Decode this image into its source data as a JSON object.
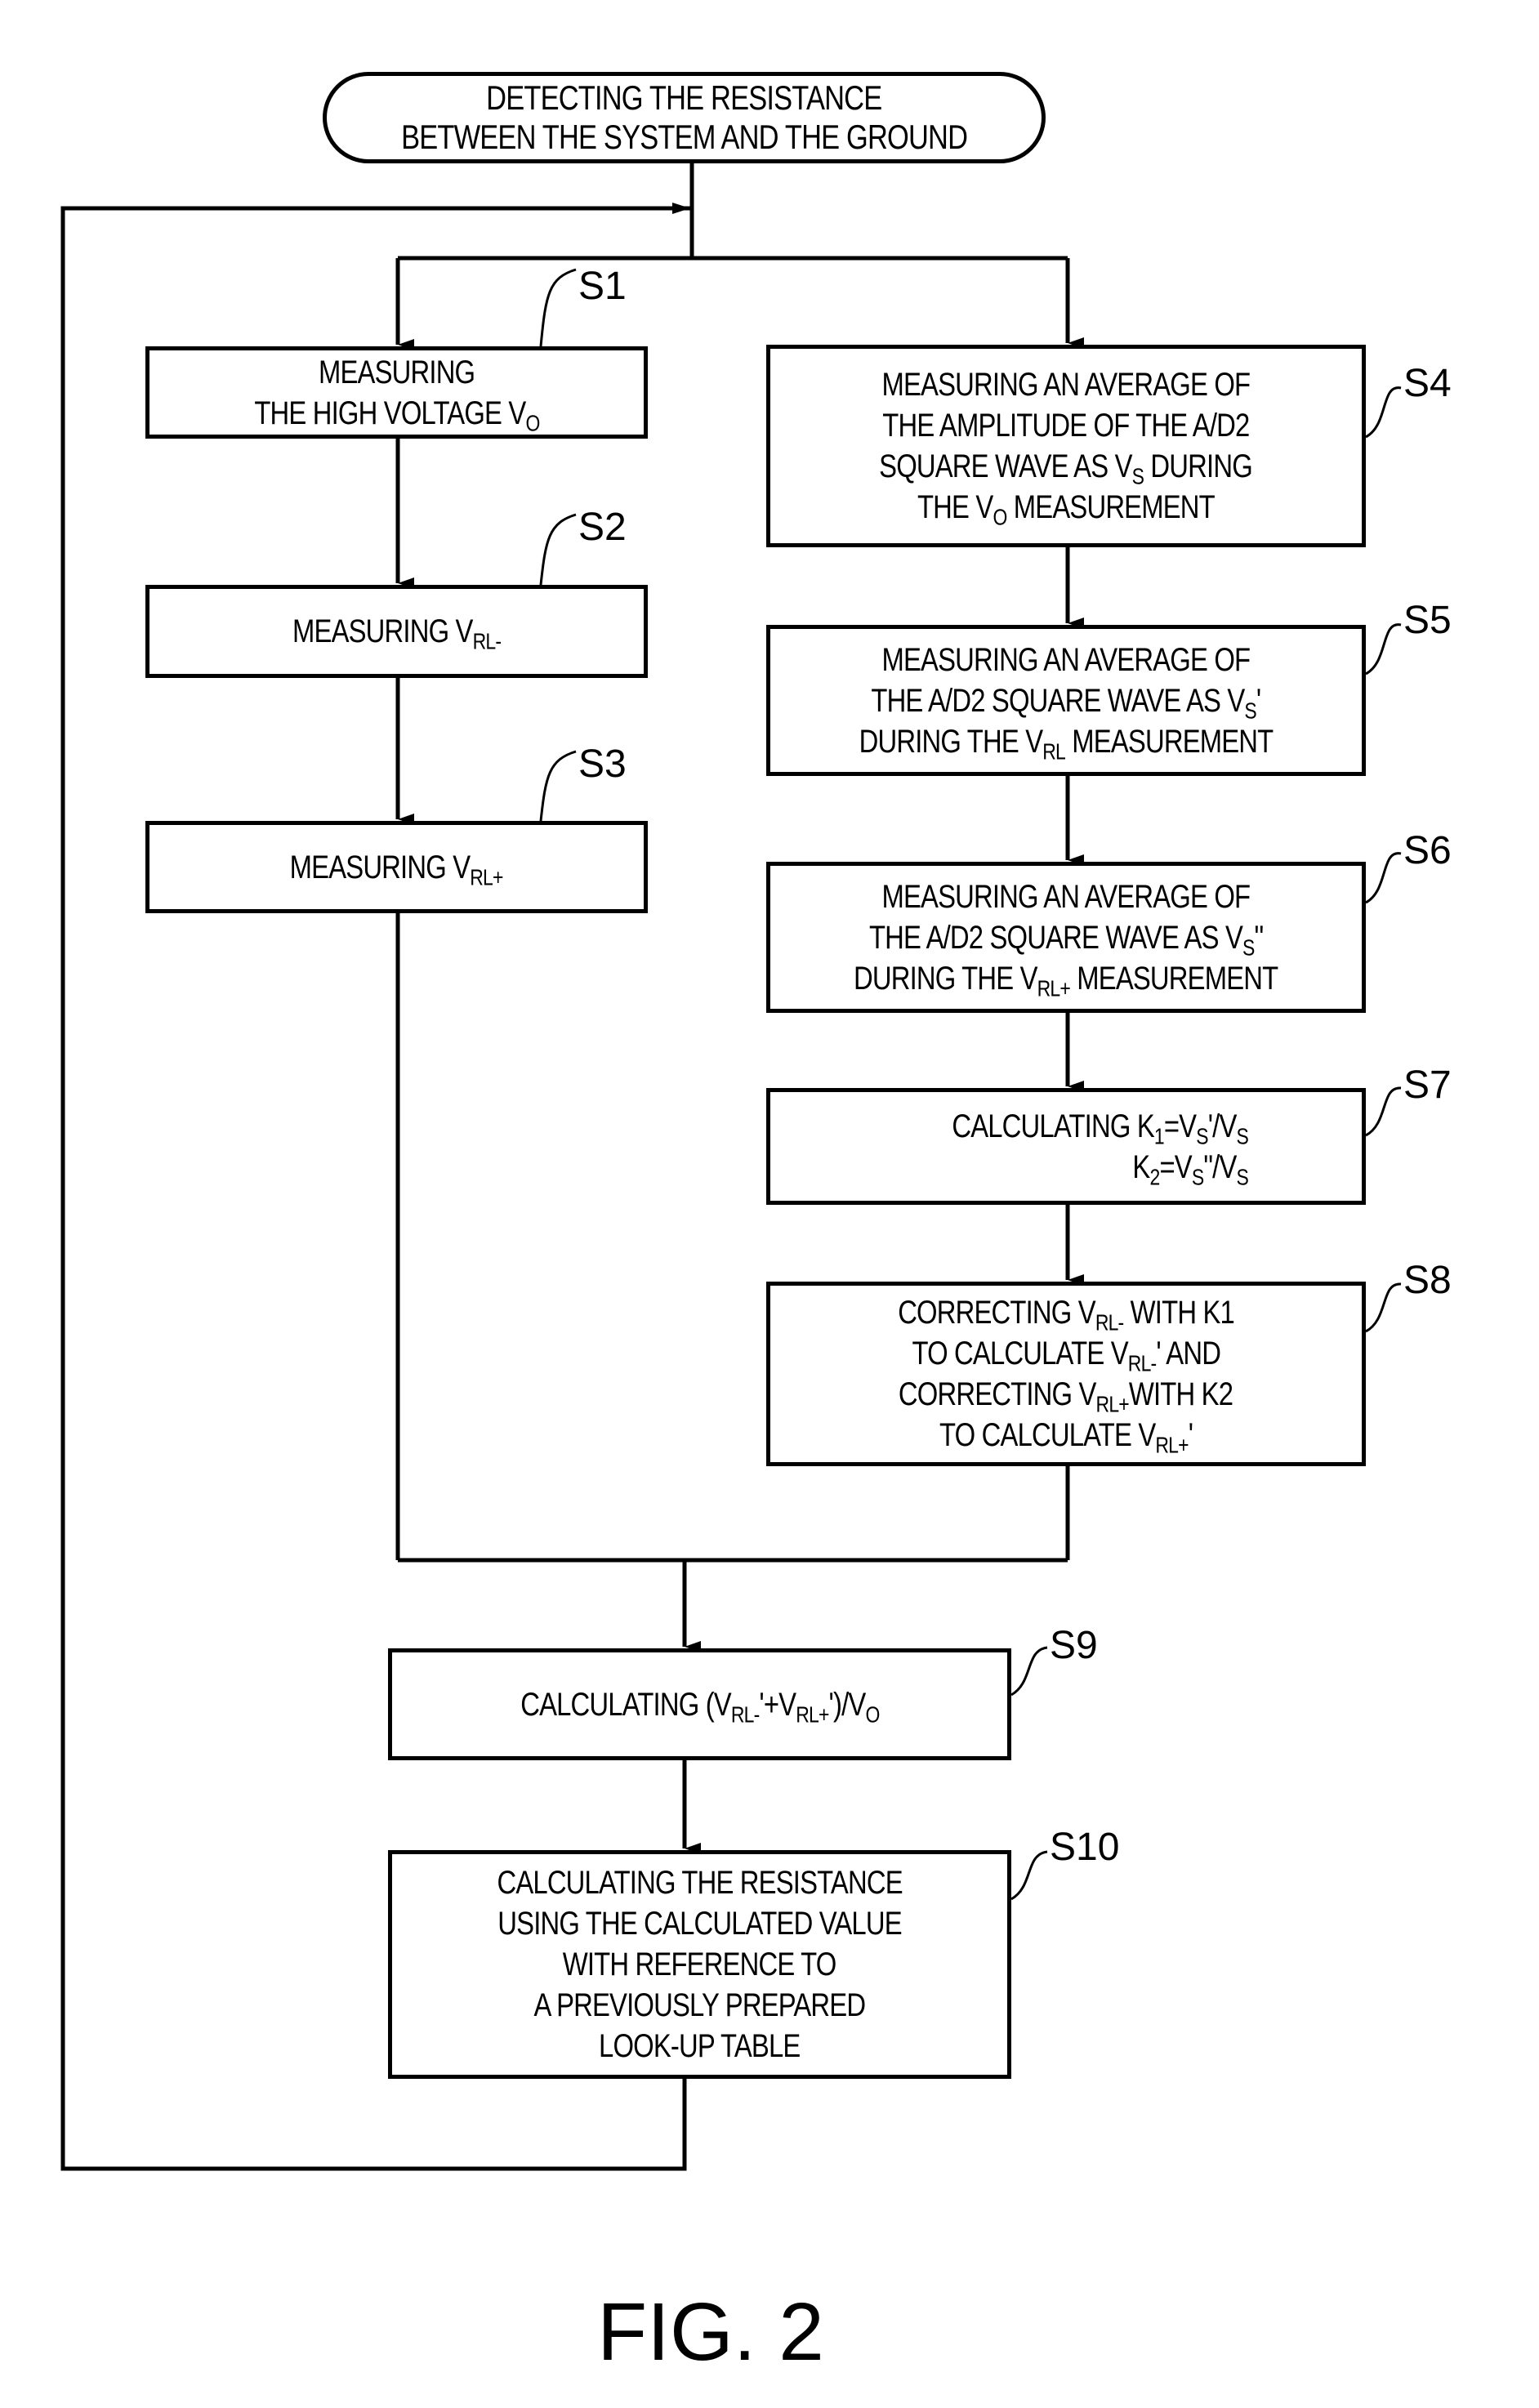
{
  "figure": {
    "caption": "FIG. 2",
    "start": {
      "lines": [
        "DETECTING THE RESISTANCE",
        "BETWEEN THE SYSTEM AND THE GROUND"
      ]
    },
    "steps": [
      {
        "id": "S1",
        "lines": [
          "MEASURING",
          "THE HIGH VOLTAGE V{O}"
        ]
      },
      {
        "id": "S2",
        "lines": [
          "MEASURING  V{RL-}"
        ]
      },
      {
        "id": "S3",
        "lines": [
          "MEASURING  V{RL+}"
        ]
      },
      {
        "id": "S4",
        "lines": [
          "MEASURING AN AVERAGE OF",
          "THE AMPLITUDE OF THE A/D2",
          "SQUARE WAVE AS V{S} DURING",
          "THE V{O} MEASUREMENT"
        ]
      },
      {
        "id": "S5",
        "lines": [
          "MEASURING AN AVERAGE OF",
          "THE A/D2 SQUARE WAVE AS V{S}'",
          "DURING THE V{RL} MEASUREMENT"
        ]
      },
      {
        "id": "S6",
        "lines": [
          "MEASURING AN AVERAGE OF",
          "THE A/D2 SQUARE WAVE AS V{S}\"",
          "DURING THE V{RL+} MEASUREMENT"
        ]
      },
      {
        "id": "S7",
        "lines": [
          "CALCULATING K{1}=V{S}'/V{S}",
          "K{2}=V{S}\"/V{S}"
        ]
      },
      {
        "id": "S8",
        "lines": [
          "CORRECTING V{RL-} WITH K1",
          "TO CALCULATE V{RL-}' AND",
          "CORRECTING V{RL+}WITH K2",
          "TO CALCULATE V{RL+}'"
        ]
      },
      {
        "id": "S9",
        "lines": [
          "CALCULATING (V{RL-}'+V{RL+}')/V{O}"
        ]
      },
      {
        "id": "S10",
        "lines": [
          "CALCULATING THE RESISTANCE",
          "USING THE CALCULATED VALUE",
          "WITH REFERENCE TO",
          "A PREVIOUSLY PREPARED",
          "LOOK-UP TABLE"
        ]
      }
    ],
    "flow": [
      [
        "START",
        "S1"
      ],
      [
        "START",
        "S4"
      ],
      [
        "S1",
        "S2"
      ],
      [
        "S2",
        "S3"
      ],
      [
        "S4",
        "S5"
      ],
      [
        "S5",
        "S6"
      ],
      [
        "S6",
        "S7"
      ],
      [
        "S7",
        "S8"
      ],
      [
        "S3",
        "S9"
      ],
      [
        "S8",
        "S9"
      ],
      [
        "S9",
        "S10"
      ],
      [
        "S10",
        "START-loop"
      ]
    ]
  }
}
